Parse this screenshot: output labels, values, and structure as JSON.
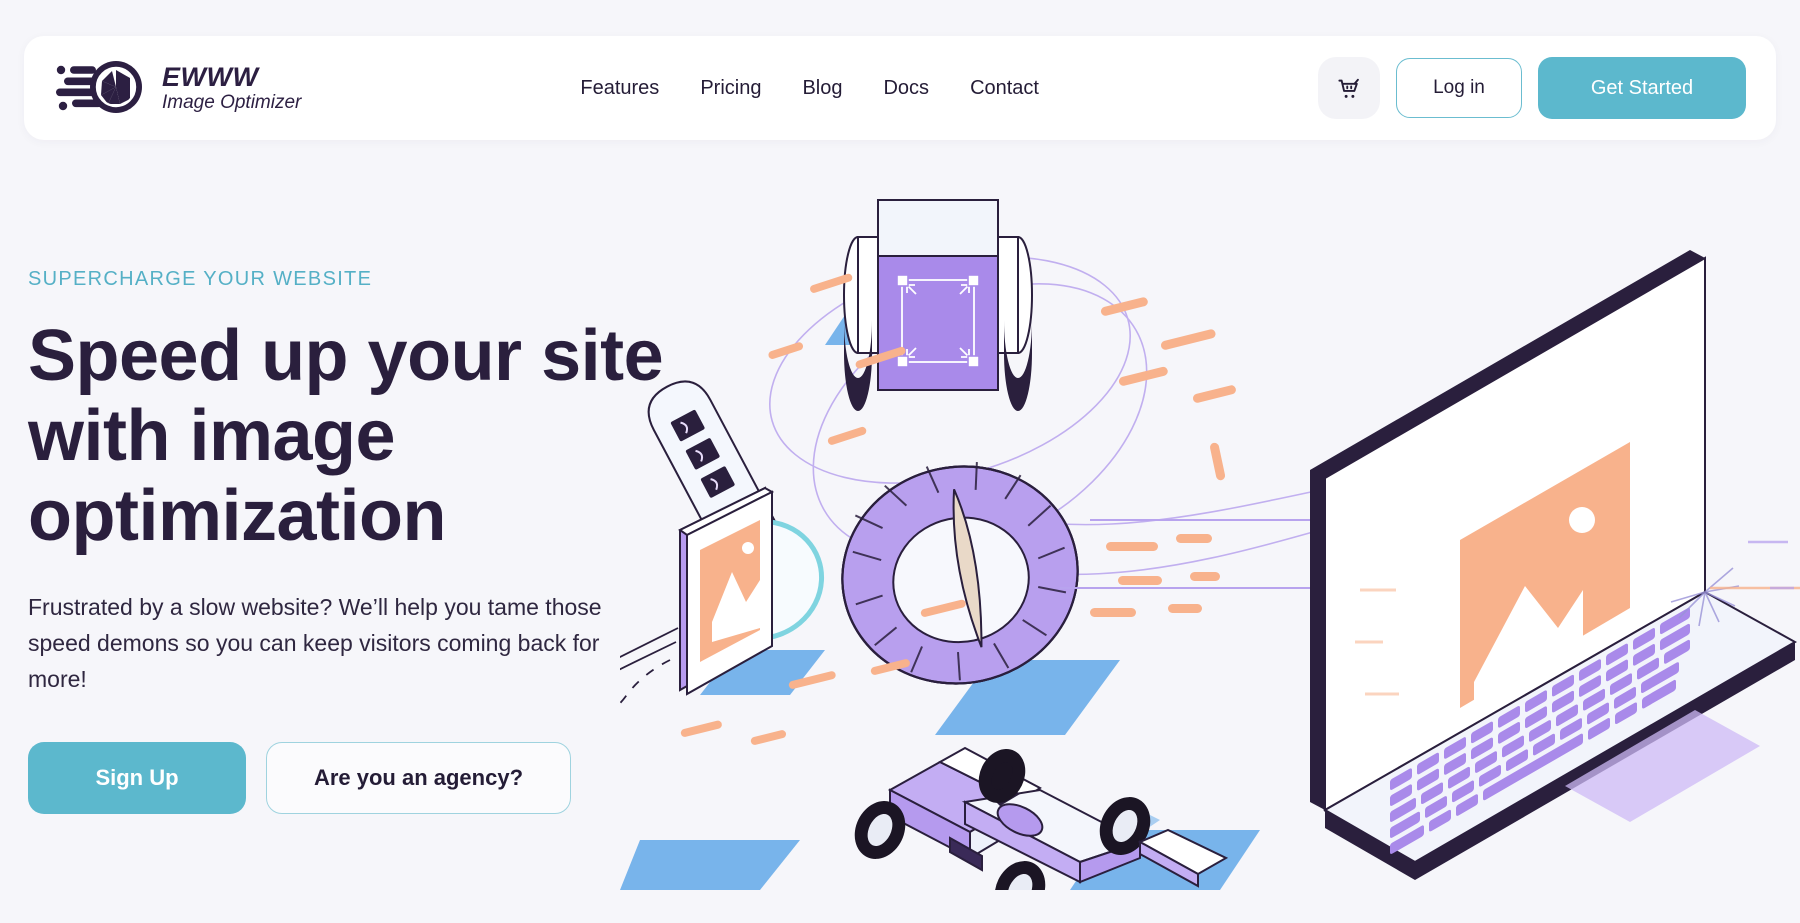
{
  "brand": {
    "name": "EWWW",
    "tagline": "Image Optimizer",
    "logo_icon": "speed-lines-aperture-icon",
    "accent_teal": "#5cb8cd",
    "dark_navy": "#2a1f3d",
    "page_background": "#f6f6fa",
    "header_background": "#ffffff"
  },
  "header": {
    "nav": [
      {
        "label": "Features"
      },
      {
        "label": "Pricing"
      },
      {
        "label": "Blog"
      },
      {
        "label": "Docs"
      },
      {
        "label": "Contact"
      }
    ],
    "cart_icon": "shopping-cart-icon",
    "login_label": "Log in",
    "get_started_label": "Get Started"
  },
  "hero": {
    "eyebrow": "SUPERCHARGE YOUR WEBSITE",
    "headline": "Speed up your site with image optimization",
    "subtext": "Frustrated by a slow website? We’ll help you tame those speed demons so you can keep visitors coming back for more!",
    "primary_cta": "Sign Up",
    "secondary_cta": "Are you an agency?",
    "illustration": {
      "name": "image-optimization-isometric-illustration",
      "elements": [
        "isometric-laptop",
        "formula-one-race-car",
        "speedometer-gauge",
        "compress-resize-tool",
        "image-card",
        "pill-module",
        "orange-speed-lines",
        "purple-orbit-rings"
      ],
      "colors": {
        "purple": "#a98aea",
        "purple_light": "#c3adf3",
        "orange": "#f8b28c",
        "blue": "#5ba3e8",
        "teal_ring": "#7fd4e0",
        "navy_outline": "#2a1f3d"
      }
    }
  }
}
